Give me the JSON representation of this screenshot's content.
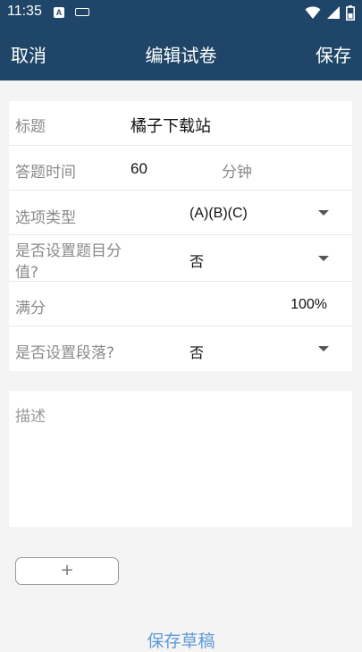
{
  "status_bar": {
    "time": "11:35",
    "icons": [
      "a-notification-icon",
      "keyboard-icon",
      "wifi-icon",
      "signal-icon",
      "battery-icon"
    ]
  },
  "app_bar": {
    "cancel_label": "取消",
    "title": "编辑试卷",
    "save_label": "保存",
    "color": "#1f4668"
  },
  "form": {
    "title_label": "标题",
    "title_value": "橘子下载站",
    "time_label": "答题时间",
    "time_value": "60",
    "time_unit": "分钟",
    "option_type_label": "选项类型",
    "option_type_value": "(A)(B)(C)",
    "score_set_label_line1": "是否设置题目分",
    "score_set_label_line2": "值?",
    "score_set_value": "否",
    "full_score_label": "满分",
    "full_score_value": "100%",
    "paragraph_label": "是否设置段落?",
    "paragraph_value": "否"
  },
  "description": {
    "placeholder": "描述"
  },
  "add_button_label": "+",
  "save_draft_label": "保存草稿",
  "link_color": "#5b9bd6"
}
